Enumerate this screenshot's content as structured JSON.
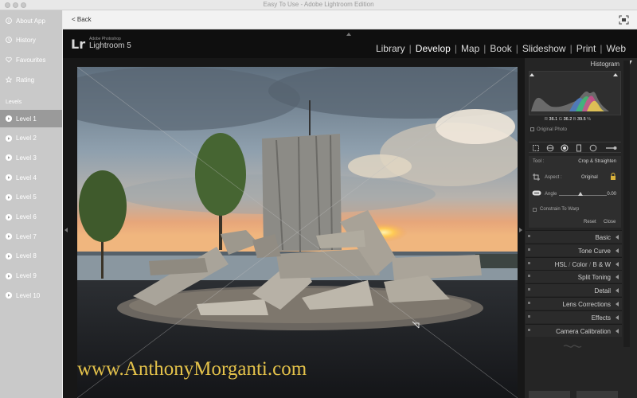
{
  "window": {
    "title": "Easy To Use - Adobe Lightroom Edition"
  },
  "sidebar": {
    "top_items": [
      {
        "label": "About App",
        "icon": "info-icon"
      },
      {
        "label": "History",
        "icon": "clock-icon"
      },
      {
        "label": "Favourites",
        "icon": "heart-icon"
      },
      {
        "label": "Rating",
        "icon": "star-icon"
      }
    ],
    "section_label": "Levels",
    "levels": [
      "Level 1",
      "Level 2",
      "Level 3",
      "Level 4",
      "Level 5",
      "Level 6",
      "Level 7",
      "Level 8",
      "Level 9",
      "Level 10"
    ],
    "active_level": "Level 1"
  },
  "nav": {
    "back_label": "< Back"
  },
  "lightroom": {
    "logo": "Lr",
    "brand_small": "Adobe Photoshop",
    "brand": "Lightroom 5",
    "modules": [
      "Library",
      "Develop",
      "Map",
      "Book",
      "Slideshow",
      "Print",
      "Web"
    ],
    "active_module": "Develop"
  },
  "panel": {
    "histogram_title": "Histogram",
    "rgb": {
      "r_label": "R",
      "r_value": "36.1",
      "g_label": "G",
      "g_value": "36.2",
      "b_label": "B",
      "b_value": "39.5",
      "unit": "%"
    },
    "original_photo": "Original Photo",
    "crop": {
      "tool_label": "Tool :",
      "tool_value": "Crop & Straighten",
      "aspect_label": "Aspect :",
      "aspect_value": "Original",
      "angle_label": "Angle",
      "angle_value": "0.00",
      "constrain_label": "Constrain To Warp",
      "reset_label": "Reset",
      "close_label": "Close"
    },
    "sections": [
      {
        "label": "Basic"
      },
      {
        "label": "Tone Curve"
      },
      {
        "label": "HSL",
        "sep1": " / ",
        "label2": "Color",
        "sep2": " / ",
        "label3": "B & W"
      },
      {
        "label": "Split Toning"
      },
      {
        "label": "Detail"
      },
      {
        "label": "Lens Corrections"
      },
      {
        "label": "Effects"
      },
      {
        "label": "Camera Calibration"
      }
    ]
  },
  "photo": {
    "watermark": "www.AnthonyMorganti.com"
  },
  "colors": {
    "sidebar_bg": "#c9c9c9",
    "active_level_bg": "#9a9a9a",
    "lr_bg": "#0f0f0f",
    "watermark": "#e4c24a"
  }
}
